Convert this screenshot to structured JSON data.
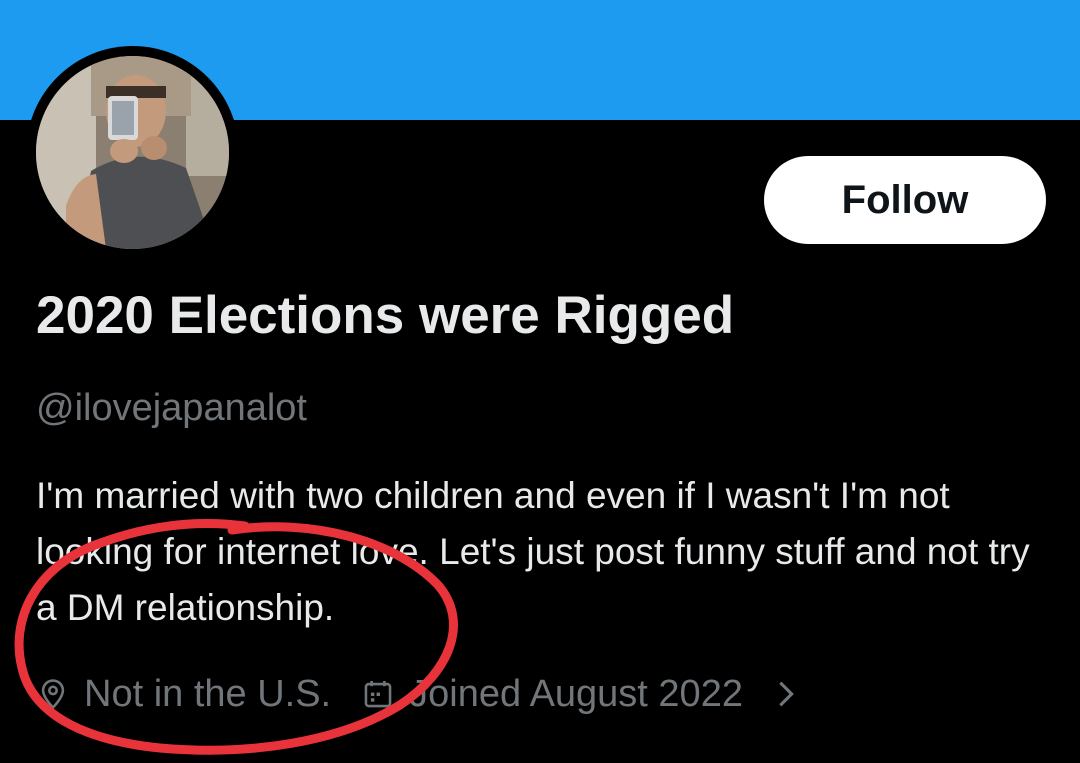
{
  "profile": {
    "display_name": "2020 Elections were Rigged",
    "handle": "@ilovejapanalot",
    "bio": "I'm married with two children and even if I wasn't I'm not looking for internet love. Let's just post funny stuff and not try a DM relationship.",
    "location": "Not in the U.S.",
    "joined": "Joined August 2022"
  },
  "actions": {
    "follow_label": "Follow"
  },
  "icons": {
    "location": "location-pin-icon",
    "joined": "calendar-icon",
    "more": "chevron-right-icon"
  },
  "colors": {
    "banner": "#1d9bf0",
    "background": "#000000",
    "primary_text": "#e7e9ea",
    "secondary_text": "#71767b",
    "button_bg": "#ffffff",
    "button_text": "#0f1419",
    "annotation": "#e8333a"
  }
}
